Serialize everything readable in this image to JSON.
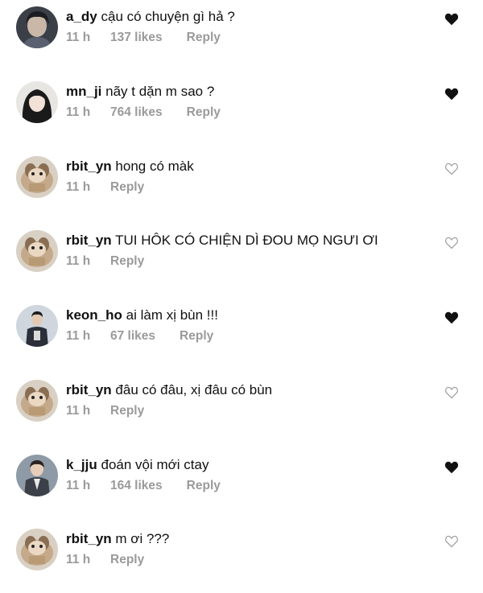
{
  "comments": [
    {
      "username": "a_dy",
      "text": "cậu có chuyện gì hả ?",
      "time": "11 h",
      "likes": "137 likes",
      "reply": "Reply",
      "liked": true,
      "heart_icon": "heart-filled-icon",
      "avatar": "boy-portrait"
    },
    {
      "username": "mn_ji",
      "text": "nãy t dặn m sao ?",
      "time": "11 h",
      "likes": "764 likes",
      "reply": "Reply",
      "liked": true,
      "heart_icon": "heart-filled-icon",
      "avatar": "girl-portrait"
    },
    {
      "username": "rbit_yn",
      "text": "hong có màk",
      "time": "11 h",
      "likes": "",
      "reply": "Reply",
      "liked": false,
      "heart_icon": "heart-outline-icon",
      "avatar": "animal-plush"
    },
    {
      "username": "rbit_yn",
      "text": "TUI HÔK CÓ CHIỆN DÌ ĐOU MỌ NGƯI ƠI",
      "time": "11 h",
      "likes": "",
      "reply": "Reply",
      "liked": false,
      "heart_icon": "heart-outline-icon",
      "avatar": "animal-plush"
    },
    {
      "username": "keon_ho",
      "text": "ai làm xị bùn !!!",
      "time": "11 h",
      "likes": "67 likes",
      "reply": "Reply",
      "liked": true,
      "heart_icon": "heart-filled-icon",
      "avatar": "boy-standing"
    },
    {
      "username": "rbit_yn",
      "text": "đâu có đâu, xị đâu có bùn",
      "time": "11 h",
      "likes": "",
      "reply": "Reply",
      "liked": false,
      "heart_icon": "heart-outline-icon",
      "avatar": "animal-plush"
    },
    {
      "username": "k_jju",
      "text": "đoán vội mới ctay",
      "time": "11 h",
      "likes": "164 likes",
      "reply": "Reply",
      "liked": true,
      "heart_icon": "heart-filled-icon",
      "avatar": "boy-jacket"
    },
    {
      "username": "rbit_yn",
      "text": "m ơi ???",
      "time": "11 h",
      "likes": "",
      "reply": "Reply",
      "liked": false,
      "heart_icon": "heart-outline-icon",
      "avatar": "animal-plush"
    }
  ],
  "colors": {
    "meta_text": "#9a9a9a",
    "text": "#111111",
    "heart_filled": "#111111",
    "heart_outline": "#9a9a9a"
  }
}
